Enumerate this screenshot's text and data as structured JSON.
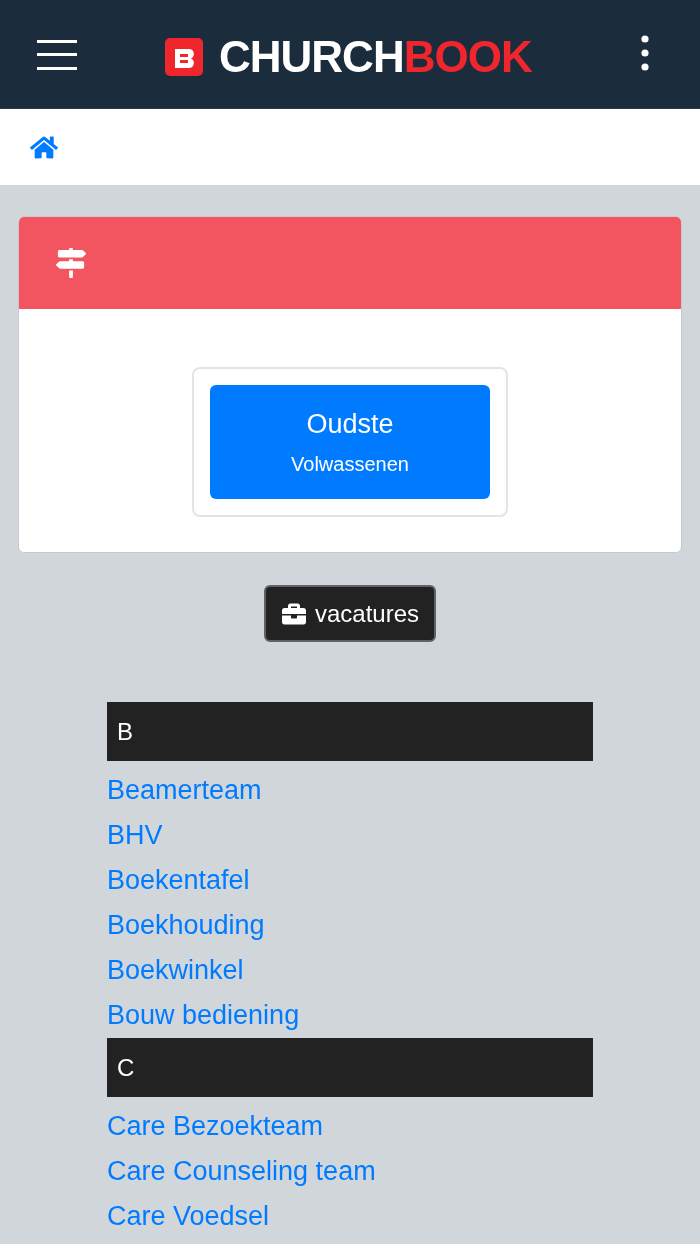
{
  "header": {
    "logo": {
      "part_1": "CHURCH",
      "part_2": "BOOK"
    }
  },
  "card": {
    "group_button": {
      "title": "Oudste",
      "subtitle": "Volwassenen"
    }
  },
  "vacatures_button": {
    "label": "vacatures"
  },
  "sections": [
    {
      "letter": "B",
      "items": [
        "Beamerteam",
        "BHV",
        "Boekentafel",
        "Boekhouding",
        "Boekwinkel",
        "Bouw bediening"
      ]
    },
    {
      "letter": "C",
      "items": [
        "Care Bezoekteam",
        "Care Counseling team",
        "Care Voedsel"
      ]
    }
  ]
}
